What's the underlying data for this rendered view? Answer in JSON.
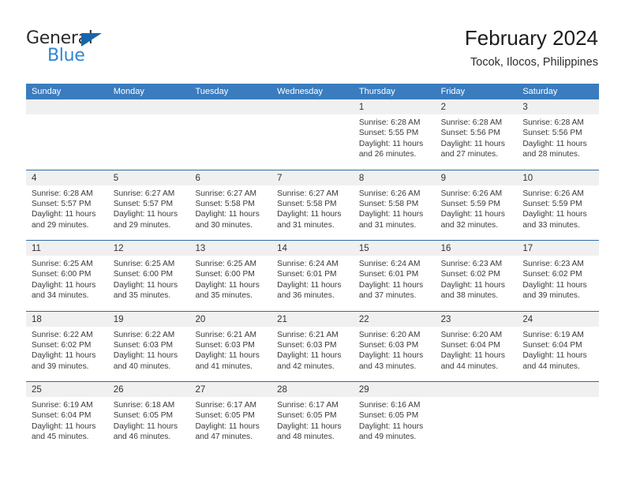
{
  "brand": {
    "name_part1": "General",
    "name_part2": "Blue",
    "triangle_color": "#1565b0",
    "blue_color": "#2e86d4"
  },
  "header": {
    "title": "February 2024",
    "subtitle": "Tocok, Ilocos, Philippines"
  },
  "theme": {
    "header_blue": "#3a7cbe",
    "row_divider_blue": "#2f6ca6",
    "day_band_gray": "#f0f0f0"
  },
  "weekdays": [
    "Sunday",
    "Monday",
    "Tuesday",
    "Wednesday",
    "Thursday",
    "Friday",
    "Saturday"
  ],
  "weeks": [
    [
      {
        "day": ""
      },
      {
        "day": ""
      },
      {
        "day": ""
      },
      {
        "day": ""
      },
      {
        "day": "1",
        "sunrise": "Sunrise: 6:28 AM",
        "sunset": "Sunset: 5:55 PM",
        "daylight1": "Daylight: 11 hours",
        "daylight2": "and 26 minutes."
      },
      {
        "day": "2",
        "sunrise": "Sunrise: 6:28 AM",
        "sunset": "Sunset: 5:56 PM",
        "daylight1": "Daylight: 11 hours",
        "daylight2": "and 27 minutes."
      },
      {
        "day": "3",
        "sunrise": "Sunrise: 6:28 AM",
        "sunset": "Sunset: 5:56 PM",
        "daylight1": "Daylight: 11 hours",
        "daylight2": "and 28 minutes."
      }
    ],
    [
      {
        "day": "4",
        "sunrise": "Sunrise: 6:28 AM",
        "sunset": "Sunset: 5:57 PM",
        "daylight1": "Daylight: 11 hours",
        "daylight2": "and 29 minutes."
      },
      {
        "day": "5",
        "sunrise": "Sunrise: 6:27 AM",
        "sunset": "Sunset: 5:57 PM",
        "daylight1": "Daylight: 11 hours",
        "daylight2": "and 29 minutes."
      },
      {
        "day": "6",
        "sunrise": "Sunrise: 6:27 AM",
        "sunset": "Sunset: 5:58 PM",
        "daylight1": "Daylight: 11 hours",
        "daylight2": "and 30 minutes."
      },
      {
        "day": "7",
        "sunrise": "Sunrise: 6:27 AM",
        "sunset": "Sunset: 5:58 PM",
        "daylight1": "Daylight: 11 hours",
        "daylight2": "and 31 minutes."
      },
      {
        "day": "8",
        "sunrise": "Sunrise: 6:26 AM",
        "sunset": "Sunset: 5:58 PM",
        "daylight1": "Daylight: 11 hours",
        "daylight2": "and 31 minutes."
      },
      {
        "day": "9",
        "sunrise": "Sunrise: 6:26 AM",
        "sunset": "Sunset: 5:59 PM",
        "daylight1": "Daylight: 11 hours",
        "daylight2": "and 32 minutes."
      },
      {
        "day": "10",
        "sunrise": "Sunrise: 6:26 AM",
        "sunset": "Sunset: 5:59 PM",
        "daylight1": "Daylight: 11 hours",
        "daylight2": "and 33 minutes."
      }
    ],
    [
      {
        "day": "11",
        "sunrise": "Sunrise: 6:25 AM",
        "sunset": "Sunset: 6:00 PM",
        "daylight1": "Daylight: 11 hours",
        "daylight2": "and 34 minutes."
      },
      {
        "day": "12",
        "sunrise": "Sunrise: 6:25 AM",
        "sunset": "Sunset: 6:00 PM",
        "daylight1": "Daylight: 11 hours",
        "daylight2": "and 35 minutes."
      },
      {
        "day": "13",
        "sunrise": "Sunrise: 6:25 AM",
        "sunset": "Sunset: 6:00 PM",
        "daylight1": "Daylight: 11 hours",
        "daylight2": "and 35 minutes."
      },
      {
        "day": "14",
        "sunrise": "Sunrise: 6:24 AM",
        "sunset": "Sunset: 6:01 PM",
        "daylight1": "Daylight: 11 hours",
        "daylight2": "and 36 minutes."
      },
      {
        "day": "15",
        "sunrise": "Sunrise: 6:24 AM",
        "sunset": "Sunset: 6:01 PM",
        "daylight1": "Daylight: 11 hours",
        "daylight2": "and 37 minutes."
      },
      {
        "day": "16",
        "sunrise": "Sunrise: 6:23 AM",
        "sunset": "Sunset: 6:02 PM",
        "daylight1": "Daylight: 11 hours",
        "daylight2": "and 38 minutes."
      },
      {
        "day": "17",
        "sunrise": "Sunrise: 6:23 AM",
        "sunset": "Sunset: 6:02 PM",
        "daylight1": "Daylight: 11 hours",
        "daylight2": "and 39 minutes."
      }
    ],
    [
      {
        "day": "18",
        "sunrise": "Sunrise: 6:22 AM",
        "sunset": "Sunset: 6:02 PM",
        "daylight1": "Daylight: 11 hours",
        "daylight2": "and 39 minutes."
      },
      {
        "day": "19",
        "sunrise": "Sunrise: 6:22 AM",
        "sunset": "Sunset: 6:03 PM",
        "daylight1": "Daylight: 11 hours",
        "daylight2": "and 40 minutes."
      },
      {
        "day": "20",
        "sunrise": "Sunrise: 6:21 AM",
        "sunset": "Sunset: 6:03 PM",
        "daylight1": "Daylight: 11 hours",
        "daylight2": "and 41 minutes."
      },
      {
        "day": "21",
        "sunrise": "Sunrise: 6:21 AM",
        "sunset": "Sunset: 6:03 PM",
        "daylight1": "Daylight: 11 hours",
        "daylight2": "and 42 minutes."
      },
      {
        "day": "22",
        "sunrise": "Sunrise: 6:20 AM",
        "sunset": "Sunset: 6:03 PM",
        "daylight1": "Daylight: 11 hours",
        "daylight2": "and 43 minutes."
      },
      {
        "day": "23",
        "sunrise": "Sunrise: 6:20 AM",
        "sunset": "Sunset: 6:04 PM",
        "daylight1": "Daylight: 11 hours",
        "daylight2": "and 44 minutes."
      },
      {
        "day": "24",
        "sunrise": "Sunrise: 6:19 AM",
        "sunset": "Sunset: 6:04 PM",
        "daylight1": "Daylight: 11 hours",
        "daylight2": "and 44 minutes."
      }
    ],
    [
      {
        "day": "25",
        "sunrise": "Sunrise: 6:19 AM",
        "sunset": "Sunset: 6:04 PM",
        "daylight1": "Daylight: 11 hours",
        "daylight2": "and 45 minutes."
      },
      {
        "day": "26",
        "sunrise": "Sunrise: 6:18 AM",
        "sunset": "Sunset: 6:05 PM",
        "daylight1": "Daylight: 11 hours",
        "daylight2": "and 46 minutes."
      },
      {
        "day": "27",
        "sunrise": "Sunrise: 6:17 AM",
        "sunset": "Sunset: 6:05 PM",
        "daylight1": "Daylight: 11 hours",
        "daylight2": "and 47 minutes."
      },
      {
        "day": "28",
        "sunrise": "Sunrise: 6:17 AM",
        "sunset": "Sunset: 6:05 PM",
        "daylight1": "Daylight: 11 hours",
        "daylight2": "and 48 minutes."
      },
      {
        "day": "29",
        "sunrise": "Sunrise: 6:16 AM",
        "sunset": "Sunset: 6:05 PM",
        "daylight1": "Daylight: 11 hours",
        "daylight2": "and 49 minutes."
      },
      {
        "day": ""
      },
      {
        "day": ""
      }
    ]
  ]
}
